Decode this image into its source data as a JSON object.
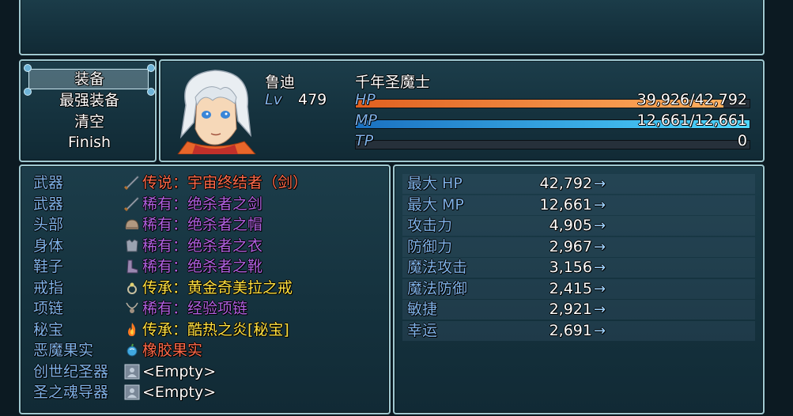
{
  "commands": [
    "装备",
    "最强装备",
    "清空",
    "Finish"
  ],
  "actor": {
    "name": "鲁迪",
    "class": "千年圣魔士",
    "level_label": "Lv",
    "level": "479",
    "hp_label": "HP",
    "hp_value": "39,926/42,792",
    "hp_fraction": 0.933,
    "mp_label": "MP",
    "mp_value": "12,661/12,661",
    "mp_fraction": 1.0,
    "tp_label": "TP",
    "tp_value": "0",
    "tp_fraction": 0.0
  },
  "slots": [
    {
      "slot": "武器",
      "icon": "sword-icon",
      "item": "传说：宇宙终结者（剑）",
      "color": "#ff6a4a"
    },
    {
      "slot": "武器",
      "icon": "sword-icon",
      "item": "稀有：绝杀者之剑",
      "color": "#b060e0"
    },
    {
      "slot": "头部",
      "icon": "helmet-icon",
      "item": "稀有：绝杀者之帽",
      "color": "#b060e0"
    },
    {
      "slot": "身体",
      "icon": "armor-icon",
      "item": "稀有：绝杀者之衣",
      "color": "#b060e0"
    },
    {
      "slot": "鞋子",
      "icon": "boots-icon",
      "item": "稀有：绝杀者之靴",
      "color": "#b060e0"
    },
    {
      "slot": "戒指",
      "icon": "ring-icon",
      "item": "传承：黄金奇美拉之戒",
      "color": "#ffe040"
    },
    {
      "slot": "项链",
      "icon": "necklace-icon",
      "item": "稀有：经验项链",
      "color": "#b060e0"
    },
    {
      "slot": "秘宝",
      "icon": "flame-icon",
      "item": "传承：酷热之炎[秘宝]",
      "color": "#ffe040"
    },
    {
      "slot": "恶魔果实",
      "icon": "fruit-icon",
      "item": "橡胶果实",
      "color": "#ff6a4a"
    },
    {
      "slot": "创世纪圣器",
      "icon": "empty-slot-icon",
      "item": "<Empty>",
      "color": "#ffffff"
    },
    {
      "slot": "圣之魂导器",
      "icon": "empty-slot-icon",
      "item": "<Empty>",
      "color": "#ffffff"
    }
  ],
  "stats": [
    {
      "name": "最大 HP",
      "value": "42,792"
    },
    {
      "name": "最大 MP",
      "value": "12,661"
    },
    {
      "name": "攻击力",
      "value": "4,905"
    },
    {
      "name": "防御力",
      "value": "2,967"
    },
    {
      "name": "魔法攻击",
      "value": "3,156"
    },
    {
      "name": "魔法防御",
      "value": "2,415"
    },
    {
      "name": "敏捷",
      "value": "2,921"
    },
    {
      "name": "幸运",
      "value": "2,691"
    }
  ],
  "arrow": "→",
  "colors": {
    "hp_start": "#e06020",
    "hp_end": "#ffb060",
    "mp_start": "#1a70c0",
    "mp_end": "#50d8ff"
  }
}
